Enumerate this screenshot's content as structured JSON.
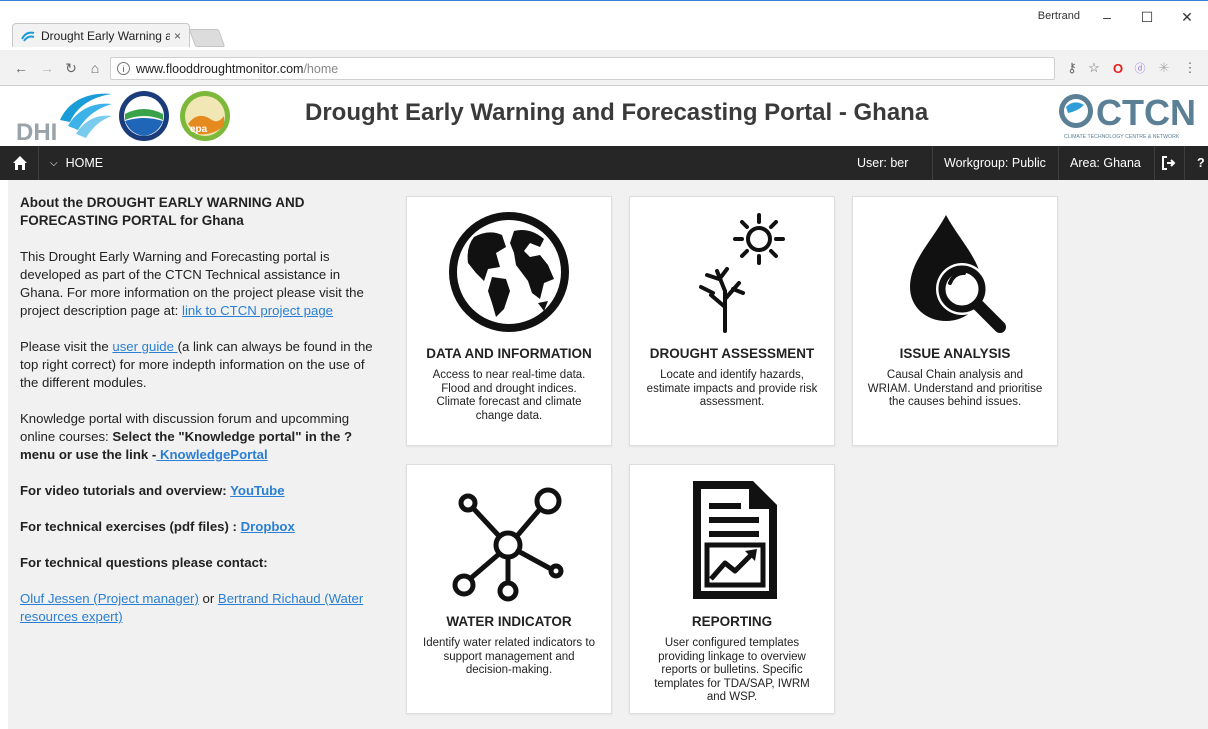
{
  "browser": {
    "tab_title": "Drought Early Warning a",
    "tab_close": "×",
    "window_user": "Bertrand",
    "win_minimize": "–",
    "win_maximize": "☐",
    "win_close": "✕",
    "url_host": "www.flooddroughtmonitor.com",
    "url_path": "/home"
  },
  "header": {
    "title": "Drought Early Warning and Forecasting Portal - Ghana"
  },
  "nav": {
    "home_label": "HOME",
    "user": "User: ber",
    "workgroup": "Workgroup: Public",
    "area": "Area: Ghana",
    "help": "?"
  },
  "about": {
    "heading": "About the DROUGHT EARLY WARNING AND FORECASTING PORTAL for Ghana",
    "intro": "This Drought Early Warning and Forecasting portal is developed as part of the CTCN Technical assistance in Ghana. For more information on the project please visit the project description page at: ",
    "intro_link": "link to CTCN project page",
    "guide_pre": "Please visit the ",
    "guide_link": "user guide ",
    "guide_post": "(a link can always be found in the top right correct) for more indepth information on the use of the different modules.",
    "knowledge_pre": "Knowledge portal with discussion forum and upcomming online courses: ",
    "knowledge_bold": "Select the \"Knowledge portal\" in the ? menu or use the link -",
    "knowledge_link": " KnowledgePortal",
    "video_label": "For video tutorials and overview: ",
    "video_link": "YouTube",
    "exercise_label": "For technical exercises (pdf files) : ",
    "exercise_link": "Dropbox",
    "contact_label": "For technical questions please contact:",
    "contact1": "Oluf Jessen (Project manager)",
    "contact_or": " or ",
    "contact2": "Bertrand Richaud (Water resources expert)"
  },
  "cards": [
    {
      "title": "DATA AND INFORMATION",
      "desc": "Access to near real-time data. Flood and drought indices. Climate forecast and climate change data.",
      "icon": "globe-icon"
    },
    {
      "title": "DROUGHT ASSESSMENT",
      "desc": "Locate and identify hazards, estimate impacts and provide risk assessment.",
      "icon": "drought-tree-sun-icon"
    },
    {
      "title": "ISSUE ANALYSIS",
      "desc": "Causal Chain analysis and WRIAM. Understand and prioritise the causes behind issues.",
      "icon": "water-drop-magnifier-icon"
    },
    {
      "title": "WATER INDICATOR",
      "desc": "Identify water related indicators to support management and decision-making.",
      "icon": "network-nodes-icon"
    },
    {
      "title": "REPORTING",
      "desc": "User configured templates providing linkage to overview reports or bulletins. Specific templates for TDA/SAP, IWRM and WSP.",
      "icon": "report-chart-icon"
    }
  ],
  "colors": {
    "nav_bg": "#262626",
    "panel_bg": "#f1f1f1",
    "link": "#2a7fd4",
    "dhi_blue": "#1a9cd8"
  }
}
